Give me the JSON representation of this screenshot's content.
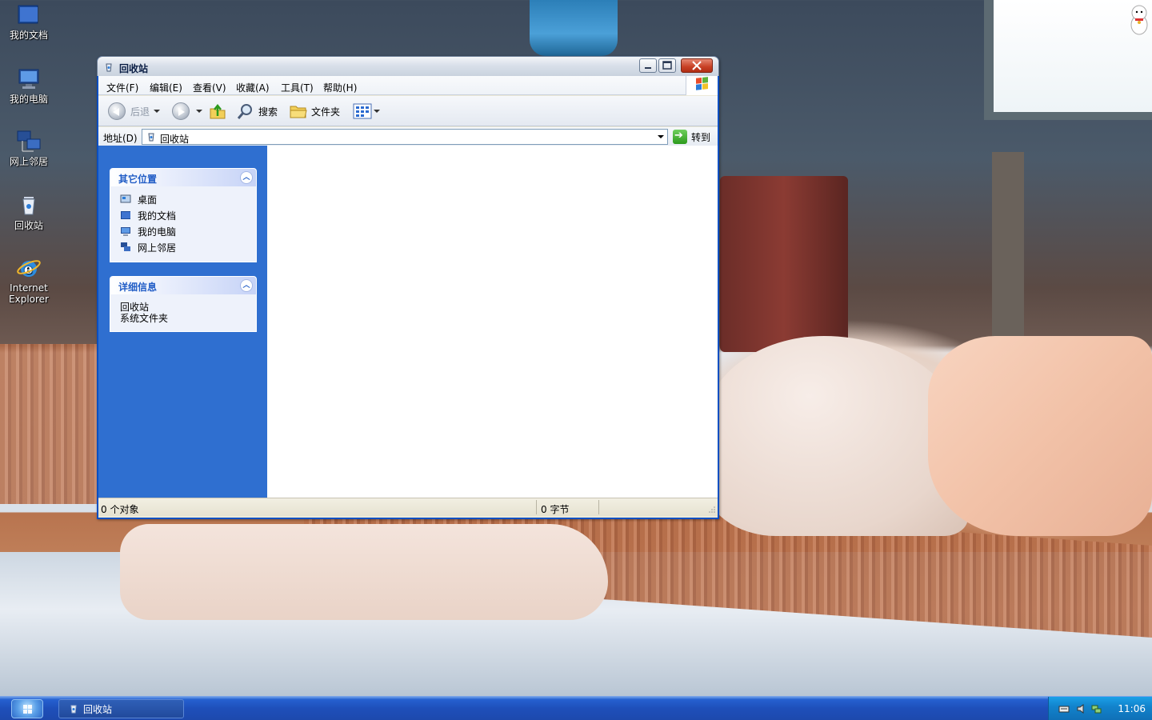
{
  "desktop": {
    "icons": [
      {
        "label": "我的文档"
      },
      {
        "label": "我的电脑"
      },
      {
        "label": "网上邻居"
      },
      {
        "label": "回收站"
      },
      {
        "label": "Internet Explorer"
      }
    ]
  },
  "window": {
    "title": "回收站",
    "menu": {
      "file": "文件(F)",
      "edit": "编辑(E)",
      "view": "查看(V)",
      "favorites": "收藏(A)",
      "tools": "工具(T)",
      "help": "帮助(H)"
    },
    "toolbar": {
      "back": "后退",
      "search": "搜索",
      "folders": "文件夹"
    },
    "address": {
      "label": "地址(D)",
      "value": "回收站",
      "go": "转到"
    },
    "sidepane": {
      "other_places": {
        "title": "其它位置",
        "links": [
          "桌面",
          "我的文档",
          "我的电脑",
          "网上邻居"
        ]
      },
      "details": {
        "title": "详细信息",
        "name": "回收站",
        "type": "系统文件夹"
      }
    },
    "status": {
      "objects": "0 个对象",
      "size": "0 字节"
    }
  },
  "taskbar": {
    "task_title": "回收站",
    "clock": "11:06"
  },
  "colors": {
    "taskbar_blue": "#1e4fba",
    "sidepane_blue": "#2f6fd0",
    "tray_blue": "#1283cc"
  }
}
